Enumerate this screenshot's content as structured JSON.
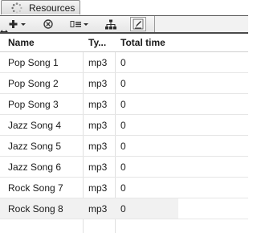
{
  "tab": {
    "label": "Resources"
  },
  "toolbar": {
    "buttons": [
      {
        "icon": "add-icon"
      },
      {
        "icon": "remove-icon"
      },
      {
        "icon": "view-options-icon"
      },
      {
        "icon": "hierarchy-icon"
      },
      {
        "icon": "edit-icon"
      }
    ]
  },
  "table": {
    "columns": [
      "Name",
      "Ty...",
      "Total time"
    ],
    "rows": [
      {
        "name": "Pop Song 1",
        "type": "mp3",
        "total_time": "0"
      },
      {
        "name": "Pop Song 2",
        "type": "mp3",
        "total_time": "0"
      },
      {
        "name": "Pop Song 3",
        "type": "mp3",
        "total_time": "0"
      },
      {
        "name": "Jazz Song 4",
        "type": "mp3",
        "total_time": "0"
      },
      {
        "name": "Jazz Song 5",
        "type": "mp3",
        "total_time": "0"
      },
      {
        "name": "Jazz Song 6",
        "type": "mp3",
        "total_time": "0"
      },
      {
        "name": "Rock Song 7",
        "type": "mp3",
        "total_time": "0"
      },
      {
        "name": "Rock Song 8",
        "type": "mp3",
        "total_time": "0"
      }
    ]
  }
}
